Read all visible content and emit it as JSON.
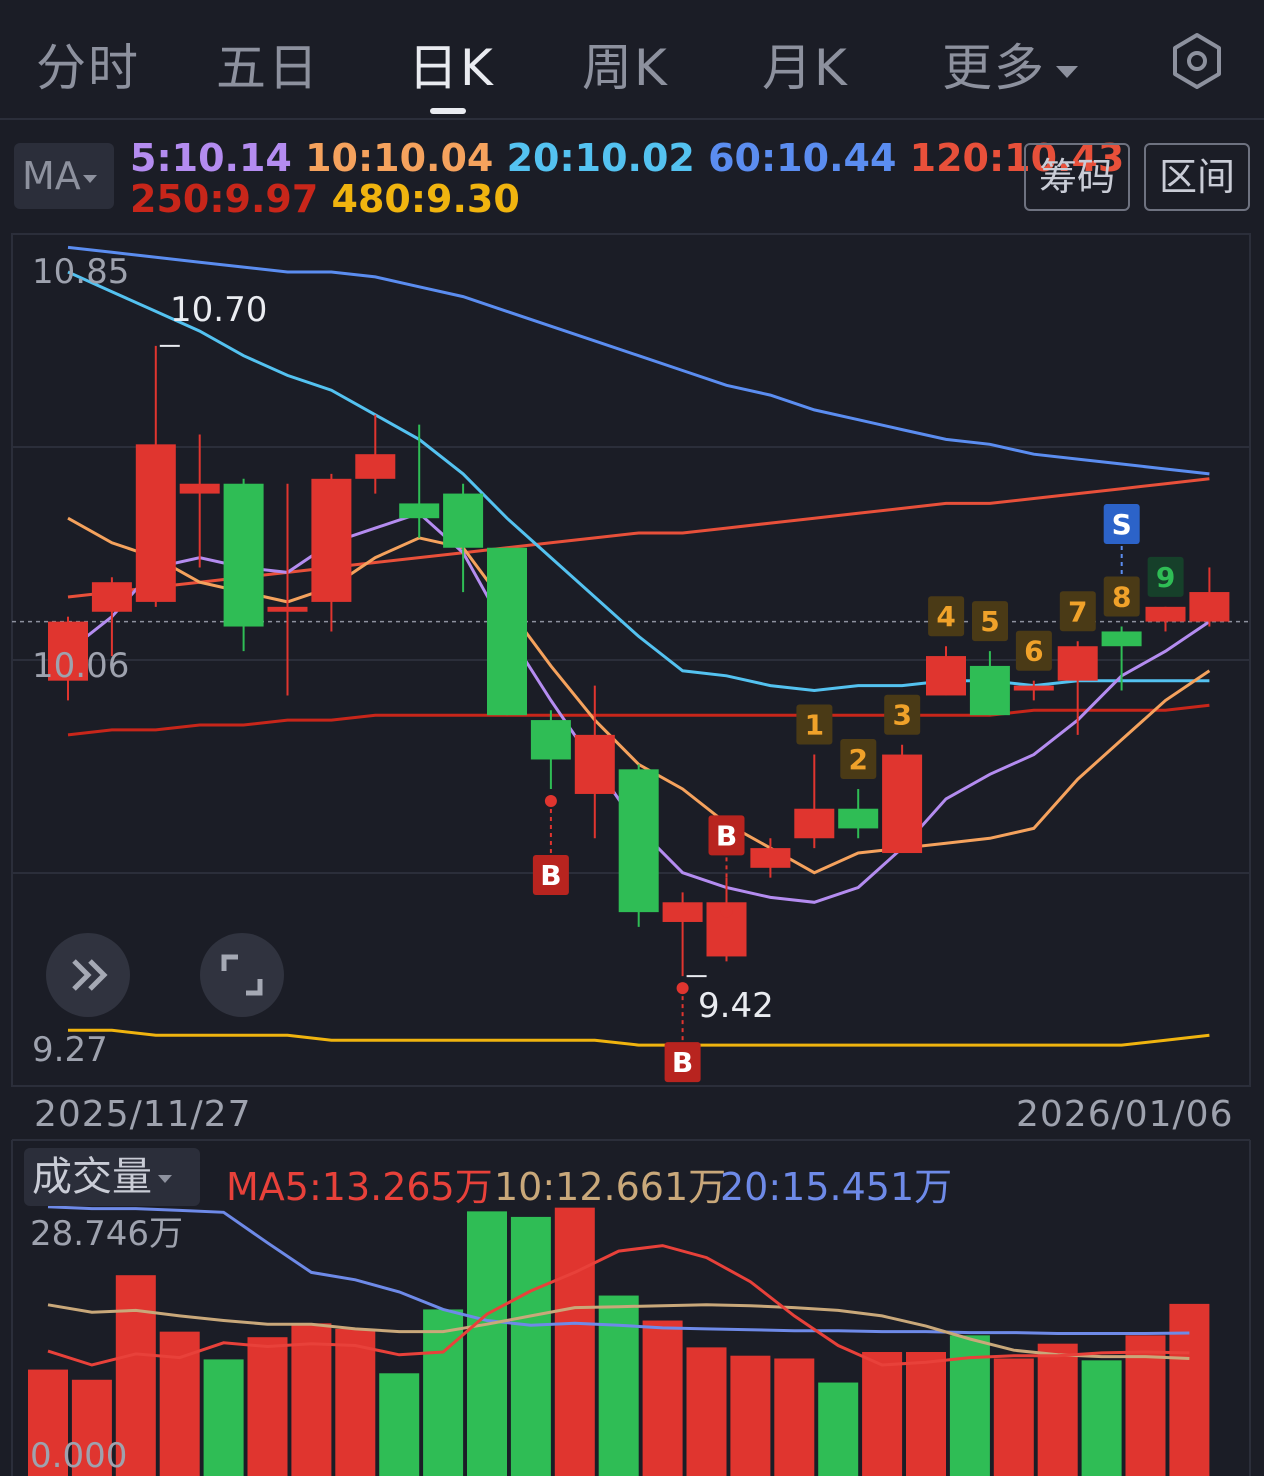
{
  "tabs": [
    {
      "label": "分时",
      "active": false
    },
    {
      "label": "五日",
      "active": false
    },
    {
      "label": "日K",
      "active": true
    },
    {
      "label": "周K",
      "active": false
    },
    {
      "label": "月K",
      "active": false
    },
    {
      "label": "更多",
      "active": false
    }
  ],
  "settings_icon": "gear-icon",
  "ma_selector": "MA",
  "ma_values": [
    {
      "label": "5:10.14",
      "color": "#b48cf0"
    },
    {
      "label": "10:10.04",
      "color": "#f5a25d"
    },
    {
      "label": "20:10.02",
      "color": "#54c2f0"
    },
    {
      "label": "60:10.44",
      "color": "#5b8df0"
    },
    {
      "label": "120:10.43",
      "color": "#e8503a"
    },
    {
      "label": "250:9.97",
      "color": "#c8261a"
    },
    {
      "label": "480:9.30",
      "color": "#f0b40f"
    }
  ],
  "buttons": {
    "chip": "筹码",
    "range": "区间"
  },
  "price_axis": {
    "top": "10.85",
    "mid": "10.06",
    "bottom": "9.27"
  },
  "high_label": "10.70",
  "low_label": "9.42",
  "date_range": {
    "start": "2025/11/27",
    "end": "2026/01/06"
  },
  "volume": {
    "selector": "成交量",
    "ma5": "MA5:13.265万",
    "ma10": "10:12.661万",
    "ma20": "20:15.451万",
    "axis_top": "28.746万",
    "axis_bottom": "0.000"
  },
  "signals": {
    "buy": "B",
    "sell": "S"
  },
  "controls": {
    "skip_icon": "double-chevron-right-icon",
    "fullscreen_icon": "fullscreen-icon"
  },
  "colors": {
    "up": "#e0352f",
    "down": "#2fbd55",
    "background": "#1b1d26"
  },
  "chart_data": {
    "type": "candlestick",
    "ylim": [
      9.27,
      10.85
    ],
    "candles": [
      {
        "open": 10.02,
        "close": 10.14,
        "high": 10.15,
        "low": 9.98
      },
      {
        "open": 10.16,
        "close": 10.22,
        "high": 10.23,
        "low": 10.07
      },
      {
        "open": 10.18,
        "close": 10.5,
        "high": 10.7,
        "low": 10.17
      },
      {
        "open": 10.42,
        "close": 10.4,
        "high": 10.52,
        "low": 10.25
      },
      {
        "open": 10.42,
        "close": 10.13,
        "high": 10.43,
        "low": 10.08
      },
      {
        "open": 10.17,
        "close": 10.16,
        "high": 10.42,
        "low": 9.99
      },
      {
        "open": 10.18,
        "close": 10.43,
        "high": 10.44,
        "low": 10.12
      },
      {
        "open": 10.43,
        "close": 10.48,
        "high": 10.56,
        "low": 10.4
      },
      {
        "open": 10.35,
        "close": 10.38,
        "high": 10.54,
        "low": 10.31
      },
      {
        "open": 10.4,
        "close": 10.29,
        "high": 10.42,
        "low": 10.2
      },
      {
        "open": 10.29,
        "close": 9.95,
        "high": 10.29,
        "low": 9.95
      },
      {
        "open": 9.94,
        "close": 9.86,
        "high": 9.96,
        "low": 9.8
      },
      {
        "open": 9.91,
        "close": 9.79,
        "high": 10.01,
        "low": 9.7
      },
      {
        "open": 9.84,
        "close": 9.55,
        "high": 9.85,
        "low": 9.52
      },
      {
        "open": 9.57,
        "close": 9.53,
        "high": 9.59,
        "low": 9.42
      },
      {
        "open": 9.57,
        "close": 9.46,
        "high": 9.62,
        "low": 9.45
      },
      {
        "open": 9.68,
        "close": 9.64,
        "high": 9.7,
        "low": 9.62
      },
      {
        "open": 9.76,
        "close": 9.7,
        "high": 9.87,
        "low": 9.68
      },
      {
        "open": 9.72,
        "close": 9.76,
        "high": 9.8,
        "low": 9.7
      },
      {
        "open": 9.87,
        "close": 9.67,
        "high": 9.89,
        "low": 9.67
      },
      {
        "open": 10.07,
        "close": 9.99,
        "high": 10.09,
        "low": 9.99
      },
      {
        "open": 9.95,
        "close": 10.05,
        "high": 10.08,
        "low": 9.95
      },
      {
        "open": 10.01,
        "close": 10.0,
        "high": 10.02,
        "low": 9.98
      },
      {
        "open": 10.09,
        "close": 10.02,
        "high": 10.1,
        "low": 9.91
      },
      {
        "open": 10.09,
        "close": 10.12,
        "high": 10.13,
        "low": 10.0
      },
      {
        "open": 10.14,
        "close": 10.17,
        "high": 10.17,
        "low": 10.12
      },
      {
        "open": 10.14,
        "close": 10.2,
        "high": 10.25,
        "low": 10.13
      }
    ],
    "up_down": [
      "up",
      "up",
      "up",
      "up",
      "down",
      "up",
      "up",
      "up",
      "down",
      "down",
      "down",
      "down",
      "up",
      "down",
      "up",
      "up",
      "up",
      "up",
      "down",
      "up",
      "up",
      "down",
      "up",
      "up",
      "down",
      "up",
      "up"
    ],
    "ma_lines": {
      "ma5": [
        10.08,
        10.15,
        10.25,
        10.27,
        10.25,
        10.24,
        10.3,
        10.33,
        10.36,
        10.28,
        10.12,
        9.98,
        9.85,
        9.72,
        9.63,
        9.6,
        9.58,
        9.57,
        9.6,
        9.68,
        9.78,
        9.83,
        9.87,
        9.94,
        10.03,
        10.08,
        10.14
      ],
      "ma10": [
        10.35,
        10.3,
        10.27,
        10.22,
        10.2,
        10.18,
        10.21,
        10.27,
        10.31,
        10.29,
        10.17,
        10.05,
        9.94,
        9.85,
        9.8,
        9.73,
        9.68,
        9.63,
        9.67,
        9.68,
        9.69,
        9.7,
        9.72,
        9.82,
        9.9,
        9.98,
        10.04
      ],
      "ma20": [
        10.85,
        10.81,
        10.77,
        10.73,
        10.68,
        10.64,
        10.61,
        10.56,
        10.51,
        10.44,
        10.35,
        10.27,
        10.19,
        10.11,
        10.04,
        10.03,
        10.01,
        10.0,
        10.01,
        10.01,
        10.02,
        10.02,
        10.01,
        10.02,
        10.02,
        10.02,
        10.02
      ],
      "ma60": [
        10.9,
        10.89,
        10.88,
        10.87,
        10.86,
        10.85,
        10.85,
        10.84,
        10.82,
        10.8,
        10.77,
        10.74,
        10.71,
        10.68,
        10.65,
        10.62,
        10.6,
        10.57,
        10.55,
        10.53,
        10.51,
        10.5,
        10.48,
        10.47,
        10.46,
        10.45,
        10.44
      ],
      "ma120": [
        10.19,
        10.2,
        10.21,
        10.22,
        10.23,
        10.24,
        10.25,
        10.26,
        10.27,
        10.28,
        10.29,
        10.3,
        10.31,
        10.32,
        10.32,
        10.33,
        10.34,
        10.35,
        10.36,
        10.37,
        10.38,
        10.38,
        10.39,
        10.4,
        10.41,
        10.42,
        10.43
      ],
      "ma250": [
        9.91,
        9.92,
        9.92,
        9.93,
        9.93,
        9.94,
        9.94,
        9.95,
        9.95,
        9.95,
        9.95,
        9.95,
        9.95,
        9.95,
        9.95,
        9.95,
        9.95,
        9.95,
        9.95,
        9.95,
        9.95,
        9.95,
        9.96,
        9.96,
        9.96,
        9.96,
        9.97
      ],
      "ma480": [
        9.31,
        9.31,
        9.3,
        9.3,
        9.3,
        9.3,
        9.29,
        9.29,
        9.29,
        9.29,
        9.29,
        9.29,
        9.29,
        9.28,
        9.28,
        9.28,
        9.28,
        9.28,
        9.28,
        9.28,
        9.28,
        9.28,
        9.28,
        9.28,
        9.28,
        9.29,
        9.3
      ]
    },
    "last_close_line": 10.14,
    "buy_signals": [
      11,
      14,
      15
    ],
    "sell_signals": [
      23
    ],
    "count_signals": [
      {
        "index": 17,
        "label": "1"
      },
      {
        "index": 18,
        "label": "2"
      },
      {
        "index": 19,
        "label": "3"
      },
      {
        "index": 20,
        "label": "4"
      },
      {
        "index": 21,
        "label": "5"
      },
      {
        "index": 22,
        "label": "6"
      },
      {
        "index": 23,
        "label": "7"
      },
      {
        "index": 24,
        "label": "8"
      },
      {
        "index": 25,
        "label": "9"
      }
    ],
    "volume_ylim": [
      0,
      28.746
    ],
    "volume_values": [
      11.5,
      10.4,
      21.7,
      15.6,
      12.6,
      15.0,
      16.5,
      15.9,
      11.1,
      18.0,
      28.6,
      28.0,
      29.0,
      19.5,
      16.8,
      13.9,
      13.0,
      12.7,
      10.1,
      13.4,
      13.4,
      15.2,
      12.7,
      14.3,
      12.5,
      15.2,
      18.6
    ],
    "volume_ma": {
      "ma5": [
        13.5,
        12.0,
        13.2,
        12.8,
        14.4,
        14.0,
        14.3,
        14.1,
        13.1,
        13.4,
        17.5,
        20.0,
        22.0,
        24.3,
        24.9,
        23.6,
        21.0,
        17.3,
        14.1,
        12.0,
        12.3,
        12.8,
        13.0,
        13.0,
        13.3,
        13.4,
        13.3
      ],
      "ma10": [
        18.5,
        17.7,
        17.9,
        17.3,
        16.8,
        16.4,
        16.4,
        15.9,
        15.6,
        15.6,
        16.4,
        17.3,
        18.2,
        18.3,
        18.4,
        18.5,
        18.4,
        18.2,
        17.9,
        17.3,
        16.2,
        14.8,
        13.6,
        13.1,
        12.9,
        12.9,
        12.7
      ],
      "ma20": [
        29.1,
        28.9,
        28.9,
        28.7,
        28.5,
        25.2,
        22.0,
        21.2,
        19.9,
        18.0,
        16.8,
        16.3,
        16.5,
        16.3,
        16.0,
        15.9,
        15.8,
        15.7,
        15.7,
        15.6,
        15.6,
        15.5,
        15.5,
        15.4,
        15.4,
        15.4,
        15.45
      ]
    }
  }
}
